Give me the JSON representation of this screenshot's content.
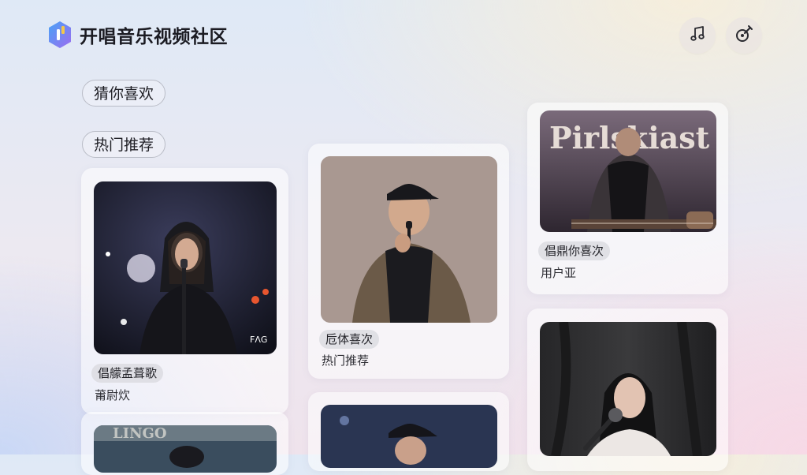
{
  "header": {
    "app_title": "开唱音乐视频社区",
    "logo_icon": "app-logo-icon",
    "buttons": [
      {
        "name": "music-button",
        "icon": "music-note-icon"
      },
      {
        "name": "edit-button",
        "icon": "guitar-edit-icon"
      }
    ]
  },
  "categories": {
    "guess_label": "猜你喜欢",
    "hot_label": "热门推荐"
  },
  "cards": [
    {
      "tag": "倡艨孟葺歌",
      "caption": "莆尉炊"
    },
    {
      "tag": "卮体喜次",
      "caption": "热门推荐"
    },
    {
      "tag": "倡鼎你喜次",
      "caption": "用户亚",
      "banner_text": "Pirlskiast"
    },
    {
      "tag": "",
      "caption": ""
    },
    {
      "tag": "",
      "caption": ""
    },
    {
      "tag": "",
      "caption": ""
    }
  ],
  "colors": {
    "accent_logo_blue": "#3d8bf2",
    "accent_logo_purple": "#9b6cf0",
    "accent_logo_yellow": "#f4c74a"
  }
}
